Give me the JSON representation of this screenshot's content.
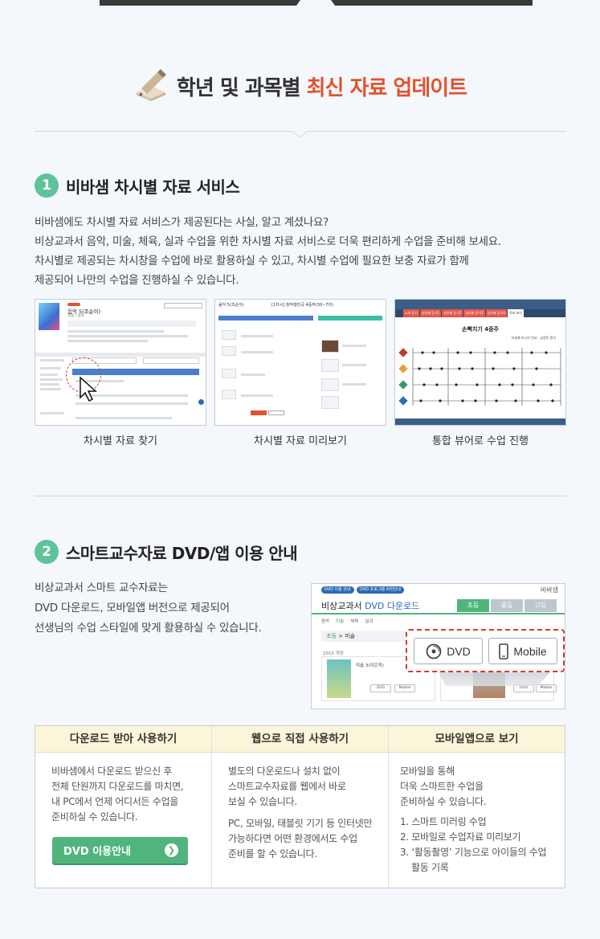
{
  "hero": {
    "title_plain": "학년 및 과목별",
    "title_highlight": "최신 자료 업데이트",
    "icon": "pencil-book-icon",
    "highlight_color": "#e0532f"
  },
  "section1": {
    "number": "1",
    "title": "비바샘 차시별 자료 서비스",
    "para": [
      "비바샘에도 차시별 자료 서비스가 제공된다는 사실, 알고 계셨나요?",
      "비상교과서 음악, 미술, 체육, 실과 수업을 위한 차시별 자료 서비스로 더욱 편리하게 수업을 준비해 보세요.",
      "차시별로 제공되는 차시창을 수업에 바로 활용하실 수 있고, 차시별 수업에 필요한 보충 자료가 함께",
      "제공되어 나만의 수업을 진행하실 수 있습니다."
    ],
    "screens": [
      {
        "caption": "차시별 자료 찾기"
      },
      {
        "caption": "차시별 자료 미리보기"
      },
      {
        "caption": "통합 뷰어로 수업 진행"
      }
    ],
    "screen1": {
      "book_title": "음악 5(조순이)",
      "book_sub": "초등 / 음악"
    },
    "screen2": {
      "title": "음악 5(조순이)",
      "sub": "[1차시] 창작행진곡 4중주(30~7차)"
    },
    "screen3": {
      "song_title": "손뼉치기 4중주",
      "song_sub": "하세계 러시아 민요 · 김정민 편곡",
      "tabs": [
        "노래 듣기",
        "성부별 듣기1",
        "성부별 듣기2",
        "성부별 듣기3",
        "성부별 듣기4",
        "악보 보기"
      ]
    }
  },
  "section2": {
    "number": "2",
    "title": "스마트교수자료 DVD/앱 이용 안내",
    "para": [
      "비상교과서 스마트 교수자료는",
      "DVD 다운로드, 모바일앱 버전으로 제공되어",
      "선생님의 수업 스타일에 맞게 활용하실 수 있습니다."
    ],
    "dvd_screen": {
      "pill1": "DVD 이용 안내",
      "pill2": "DVD 프로그램 버전안내",
      "logo": "비바샘",
      "title_prefix": "비상교과서",
      "title_blue": "DVD 다운로드",
      "tabs": [
        "초등",
        "중등",
        "고등"
      ],
      "subnav": [
        "음악",
        "미술",
        "체육",
        "실과"
      ],
      "crumb_green": "초등",
      "crumb_rest": " > 미술",
      "year": "2015 개정",
      "book_label": "미술 3(이은적)",
      "mini_dvd": "DVD",
      "mini_mobile": "Mobile",
      "btn_dvd": "DVD",
      "btn_mobile": "Mobile"
    },
    "options": [
      {
        "head": "다운로드 받아 사용하기",
        "body": [
          "비바샘에서 다운로드 받으신 후",
          "전체 단원까지 다운로드를 마치면,",
          "내 PC에서 언제 어디서든 수업을",
          "준비하실 수 있습니다."
        ],
        "button": "DVD 이용안내"
      },
      {
        "head": "웹으로 직접 사용하기",
        "body": [
          "별도의 다운로드나 설치 없이",
          "스마트교수자료를 웹에서 바로",
          "보실 수 있습니다."
        ],
        "body2": [
          "PC, 모바일, 태블릿 기기 등 인터넷만",
          "가능하다면 어떤 환경에서도 수업",
          "준비를 할 수 있습니다."
        ]
      },
      {
        "head": "모바일앱으로 보기",
        "body": [
          "모바일을 통해",
          "더욱 스마트한 수업을",
          "준비하실 수 있습니다."
        ],
        "list": [
          "1. 스마트 미러링 수업",
          "2. 모바일로 수업자료 미리보기",
          "3. ‘활동촬영’ 기능으로 아이들의 수업 활동 기록"
        ]
      }
    ],
    "accent_color": "#4fb57c"
  }
}
